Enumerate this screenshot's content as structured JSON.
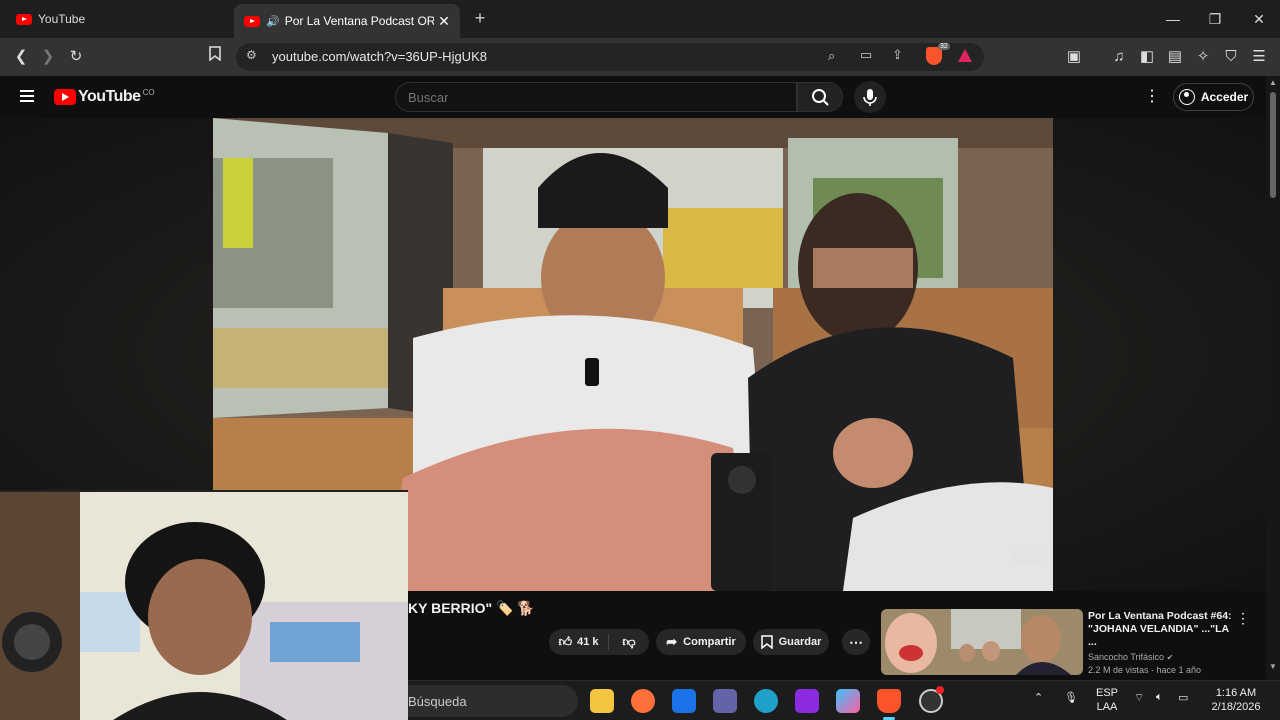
{
  "browser": {
    "tabs": [
      {
        "title": "YouTube",
        "active": false
      },
      {
        "title": "Por La Ventana Podcast ORDE",
        "active": true
      }
    ],
    "url": "youtube.com/watch?v=36UP-HjgUK8",
    "shield_badge": "32"
  },
  "youtube": {
    "logo_text": "YouTube",
    "country_code": "CO",
    "search_placeholder": "Buscar",
    "sign_in_label": "Acceder"
  },
  "video": {
    "title_fragment": "KY BERRIO\" 🏷️ 🐕",
    "watermark": "SANCOCHO TRIFÁSICO",
    "likes": "41 k",
    "share_label": "Compartir",
    "save_label": "Guardar"
  },
  "recommended": {
    "title_line1": "Por La Ventana Podcast #64:",
    "title_line2": "\"JOHANA VELANDIA\" ...\"LA ...",
    "channel": "Sancocho Trifásico",
    "meta": "2.2 M de vistas · hace 1 año"
  },
  "taskbar": {
    "search_placeholder": "Búsqueda",
    "lang_top": "ESP",
    "lang_bottom": "LAA",
    "time": "1:16 AM",
    "date": "2/18/2026"
  },
  "colors": {
    "brand_red": "#ff0000",
    "bg_dark": "#0f0f0f",
    "pill": "#272727"
  }
}
